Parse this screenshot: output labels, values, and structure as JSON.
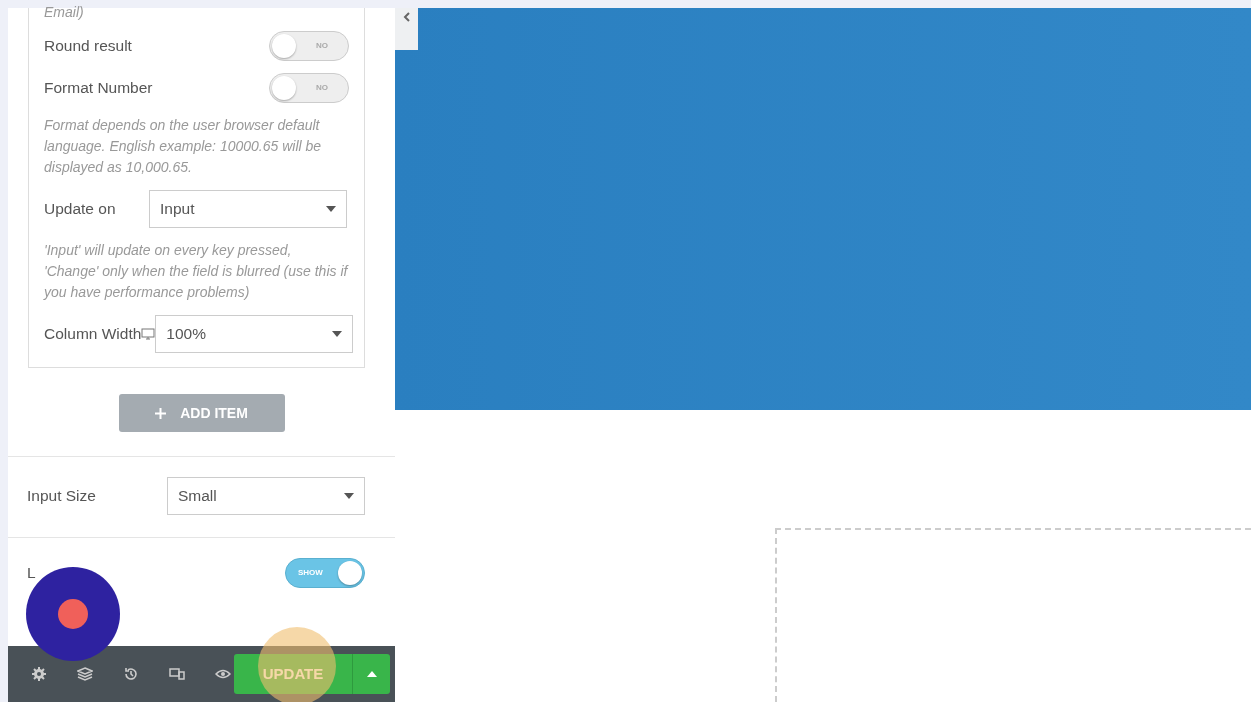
{
  "panel": {
    "cut_text": "Email)",
    "fields": [
      {
        "kind": "switch",
        "label": "Round result",
        "on": false,
        "switch_text": "NO"
      },
      {
        "kind": "switch",
        "label": "Format Number",
        "on": false,
        "switch_text": "NO"
      },
      {
        "kind": "note",
        "text": "Format depends on the user browser default language. English example: 10000.65 will be displayed as 10,000.65."
      },
      {
        "kind": "select",
        "label": "Update on",
        "value": "Input"
      },
      {
        "kind": "note",
        "text": "'Input' will update on every key pressed, 'Change' only when the field is blurred (use this if you have performance problems)"
      },
      {
        "kind": "select",
        "label": "Column Width",
        "value": "100%",
        "responsive": true
      }
    ],
    "add_button": "ADD ITEM",
    "input_size": {
      "label": "Input Size",
      "value": "Small"
    },
    "label_row": {
      "label": "L",
      "on": true,
      "switch_text": "SHOW"
    }
  },
  "footer": {
    "update_button": "UPDATE"
  }
}
